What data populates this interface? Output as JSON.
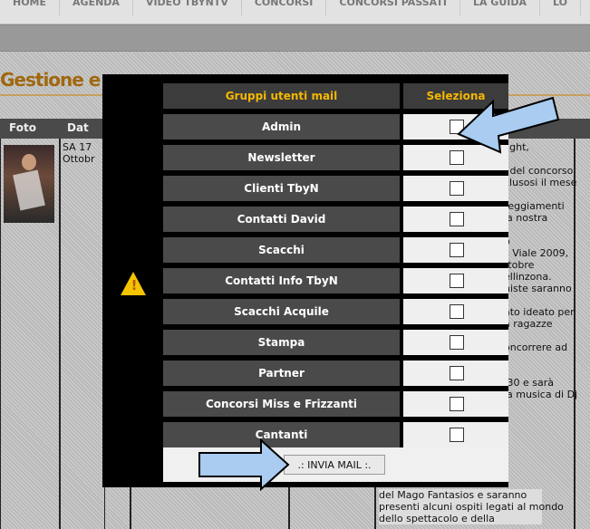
{
  "topnav": [
    "HOME",
    "AGENDA",
    "VIDEO TBYNTV",
    "CONCORSI",
    "CONCORSI PASSATI",
    "LA GUIDA",
    "LO"
  ],
  "page_title": "Gestione e",
  "table_headers": {
    "foto": "Foto",
    "data": "Dat"
  },
  "bg_date": [
    "SA 17",
    "Ottobr"
  ],
  "bg_text": [
    "light,",
    "",
    "i del concorso",
    "clusosi il mese",
    "",
    "teggiamenti",
    "la nostra",
    "",
    "o",
    "s Viale 2009,",
    "ttobre",
    "ellinzona.",
    "niste saranno",
    "",
    "ato ideato per",
    "a ragazze",
    "",
    "oncorrere ad",
    "",
    "",
    ".30 e sarà",
    "la musica di Dj"
  ],
  "bg_bottom": [
    "del Mago Fantasios e saranno",
    "presenti alcuni ospiti legati al mondo",
    "dello spettacolo e della"
  ],
  "modal": {
    "header_group": "Gruppi utenti mail",
    "header_select": "Seleziona",
    "groups": [
      {
        "label": "Admin",
        "checked": false
      },
      {
        "label": "Newsletter",
        "checked": false
      },
      {
        "label": "Clienti TbyN",
        "checked": false
      },
      {
        "label": "Contatti David",
        "checked": false
      },
      {
        "label": "Scacchi",
        "checked": false
      },
      {
        "label": "Contatti Info TbyN",
        "checked": false
      },
      {
        "label": "Scacchi Acquile",
        "checked": false
      },
      {
        "label": "Stampa",
        "checked": false
      },
      {
        "label": "Partner",
        "checked": false
      },
      {
        "label": "Concorsi Miss e Frizzanti",
        "checked": false
      },
      {
        "label": "Cantanti",
        "checked": false
      }
    ],
    "submit_label": ".: INVIA MAIL :."
  },
  "colors": {
    "accent": "#f5b800",
    "row_bg": "#4a4a4a",
    "arrow_fill": "#a9ccf0",
    "title": "#a0680f"
  },
  "icons": [
    "warning-icon",
    "pointer-arrow-icon"
  ]
}
